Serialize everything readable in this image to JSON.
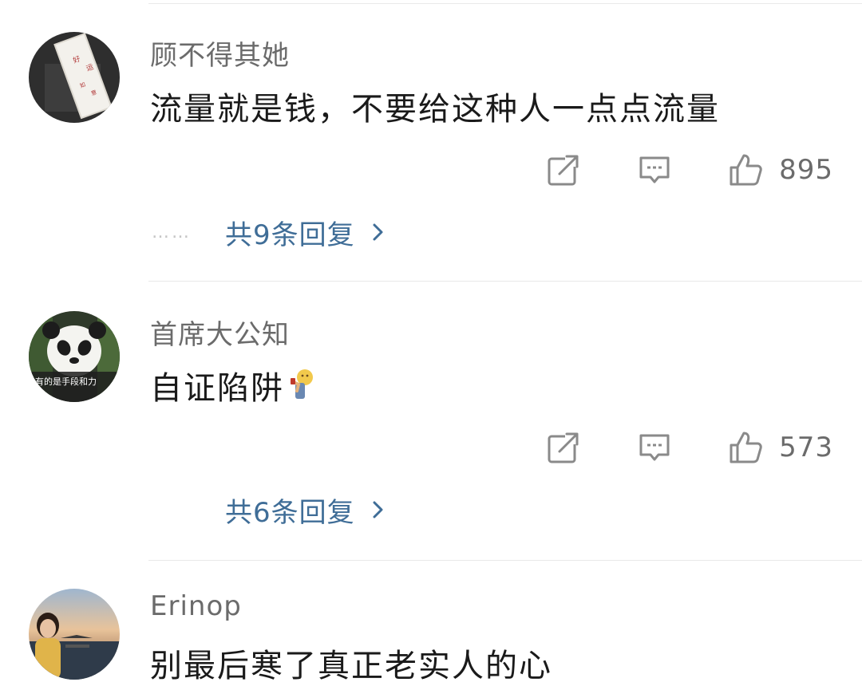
{
  "comments": [
    {
      "username": "顾不得其她",
      "text": "流量就是钱，不要给这种人一点点流量",
      "likes": "895",
      "replies_dots": "……",
      "replies_label": "共9条回复",
      "avatar_icon": "photo-avatar"
    },
    {
      "username": "首席大公知",
      "text": "自证陷阱",
      "emoji": "thinking-emoji",
      "likes": "573",
      "replies_label": "共6条回复",
      "avatar_text": "有的是手段和力",
      "avatar_icon": "panda-avatar"
    },
    {
      "username": "Erinop",
      "text": "别最后寒了真正老实人的心",
      "avatar_icon": "photo-avatar"
    }
  ],
  "icons": [
    "share-icon",
    "comment-icon",
    "like-icon",
    "chevron-right-icon"
  ],
  "colors": {
    "username": "#6b6b6b",
    "text": "#1a1a1a",
    "link": "#3f6d97",
    "icon": "#8a8a8a",
    "divider": "#e9e9e9"
  }
}
